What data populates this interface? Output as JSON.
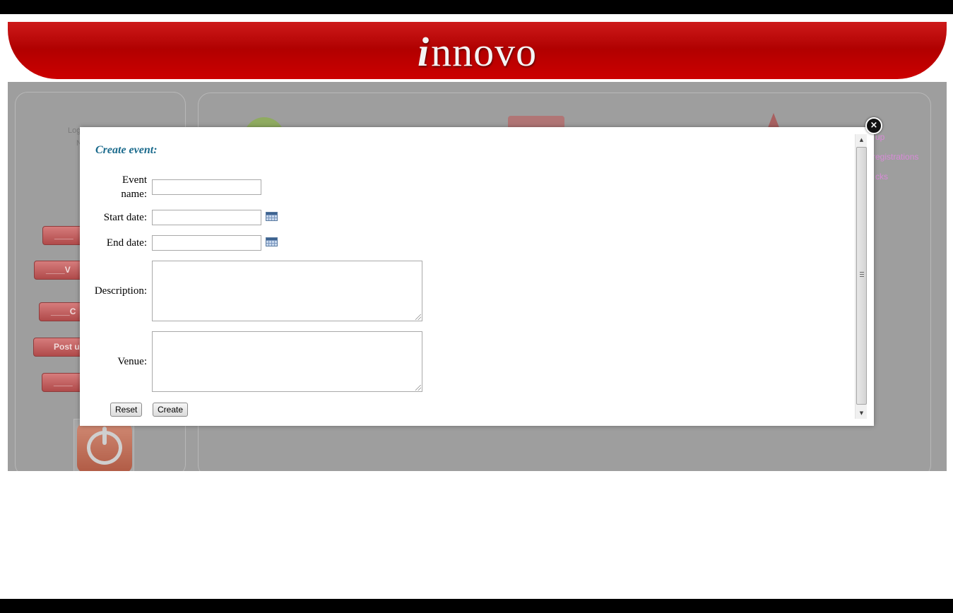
{
  "header": {
    "logo_i": "i",
    "logo_rest": "nnovo"
  },
  "background": {
    "left_panel": {
      "text_lines": [
        "Log",
        "N"
      ],
      "buttons": [
        "____",
        "____V",
        "____C",
        "Post u",
        "____"
      ]
    },
    "right_links": [
      "up",
      "registrations",
      "cks"
    ],
    "colors": {
      "banner": "#c00000",
      "overlay": "#9e9e9e"
    }
  },
  "dialog": {
    "title": "Create event:",
    "fields": {
      "event_name_label_1": "Event",
      "event_name_label_2": "name:",
      "start_date_label": "Start date:",
      "end_date_label": "End date:",
      "description_label": "Description:",
      "venue_label": "Venue:"
    },
    "values": {
      "event_name": "",
      "start_date": "",
      "end_date": "",
      "description": "",
      "venue": ""
    },
    "buttons": {
      "reset": "Reset",
      "create": "Create"
    },
    "close_symbol": "×",
    "title_color": "#1a6a8c"
  },
  "icons": [
    "calendar-icon",
    "close-icon",
    "power-icon"
  ]
}
